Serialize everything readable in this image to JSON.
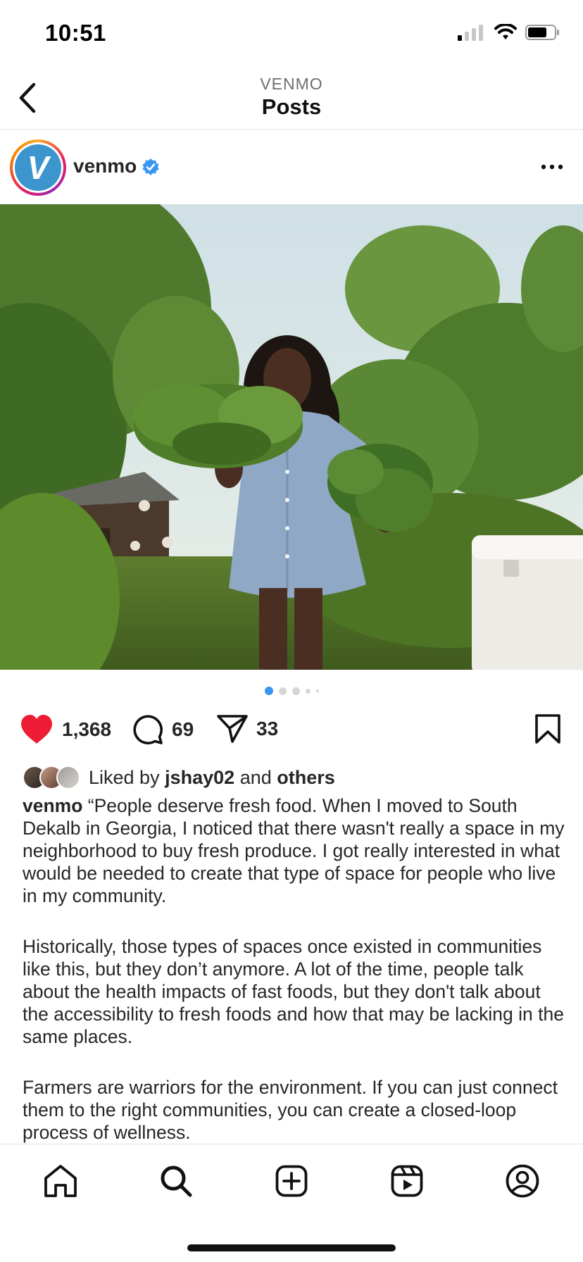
{
  "status_bar": {
    "time": "10:51"
  },
  "header": {
    "subtitle": "VENMO",
    "title": "Posts"
  },
  "post": {
    "username": "venmo",
    "avatar_letter": "V",
    "brand_color": "#3d95ce",
    "verified_color": "#3897f0",
    "carousel": {
      "total": 5,
      "active": 1
    },
    "like_count": "1,368",
    "comment_count": "69",
    "share_count": "33",
    "liked_by": {
      "prefix": "Liked by",
      "user": "jshay02",
      "conj": "and",
      "others": "others"
    },
    "caption": {
      "user": "venmo",
      "paragraphs": [
        "“People deserve fresh food. When I moved to South Dekalb in Georgia, I noticed that there wasn't really a space in my neighborhood to buy fresh produce. I got really interested in what would be needed to create that type of space for people who live in my community.",
        "Historically, those types of spaces once existed in communities like this, but they don’t anymore. A lot of the time, people talk about the health impacts of fast foods, but they don't talk about the accessibility to fresh foods and how that may be lacking in the same places.",
        "Farmers are warriors for the environment. If you can just connect them to the right communities, you can create a closed-loop process of wellness."
      ]
    }
  },
  "tab_bar": {
    "items": [
      "home-icon",
      "search-icon",
      "create-icon",
      "reels-icon",
      "profile-icon"
    ]
  }
}
